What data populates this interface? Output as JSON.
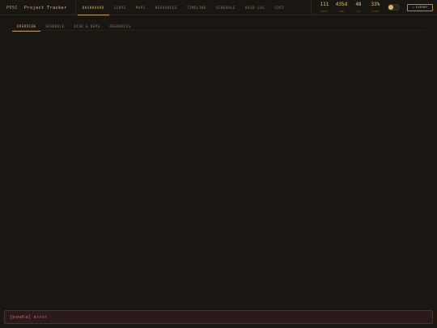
{
  "brand": {
    "code": "P55C",
    "name": "Project Tracker"
  },
  "nav": {
    "tabs": [
      {
        "label": "DASHBOARD",
        "active": true
      },
      {
        "label": "SCOPE",
        "active": false
      },
      {
        "label": "MAPS",
        "active": false
      },
      {
        "label": "RESOURCES",
        "active": false
      },
      {
        "label": "TIMELINE",
        "active": false
      },
      {
        "label": "SCHEDULE",
        "active": false
      },
      {
        "label": "RAID LOG",
        "active": false
      },
      {
        "label": "COST",
        "active": false
      }
    ]
  },
  "stats": [
    {
      "value": "111",
      "label": "WPKS"
    },
    {
      "value": "435d",
      "label": "DUR"
    },
    {
      "value": "48",
      "label": "CP"
    },
    {
      "value": "33%",
      "label": "DONE"
    }
  ],
  "toggle": {
    "icon": "sun-icon",
    "glyph": "☼"
  },
  "export": {
    "label": "EXPORT",
    "icon_glyph": "↓"
  },
  "subtabs": [
    {
      "label": "OVERVIEW",
      "active": true
    },
    {
      "label": "SCHEDULE",
      "active": false
    },
    {
      "label": "RISK & DEPS",
      "active": false
    },
    {
      "label": "RESOURCES",
      "active": false
    }
  ],
  "error": {
    "message": "[bundle] error"
  },
  "colors": {
    "accent": "#c9a050",
    "background": "#1a1712",
    "error": "#d07070"
  }
}
